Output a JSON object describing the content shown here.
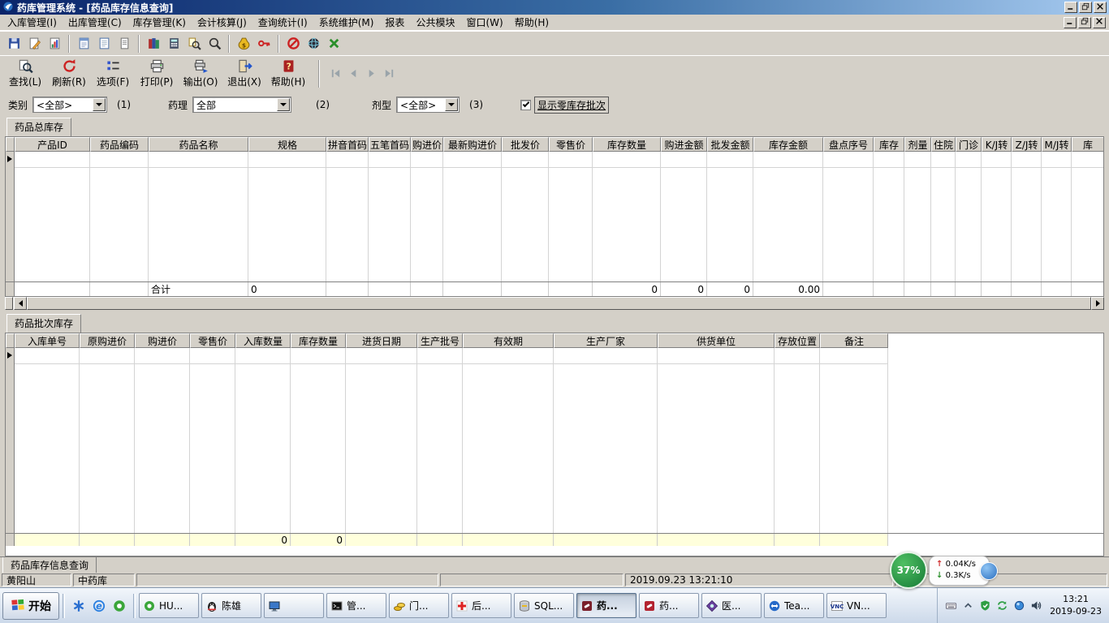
{
  "window": {
    "title": "药库管理系统 - [药品库存信息查询]"
  },
  "menu": {
    "items": [
      "入库管理(I)",
      "出库管理(C)",
      "库存管理(K)",
      "会计核算(J)",
      "查询统计(I)",
      "系统维护(M)",
      "报表",
      "公共模块",
      "窗口(W)",
      "帮助(H)"
    ]
  },
  "toolbar_small": {
    "icons": [
      "save",
      "edit",
      "report",
      "|",
      "notepad",
      "preview",
      "document",
      "|",
      "books",
      "calculator",
      "zoom-doc",
      "zoom",
      "|",
      "money",
      "key",
      "|",
      "forbid",
      "globe",
      "close-x"
    ]
  },
  "toolbar_actions": {
    "buttons": [
      {
        "icon": "search",
        "label": "查找(L)"
      },
      {
        "icon": "refresh",
        "label": "刷新(R)"
      },
      {
        "icon": "options",
        "label": "选项(F)"
      },
      {
        "icon": "printer",
        "label": "打印(P)"
      },
      {
        "icon": "export",
        "label": "输出(O)"
      },
      {
        "icon": "exit",
        "label": "退出(X)"
      },
      {
        "icon": "help",
        "label": "帮助(H)"
      }
    ],
    "nav": [
      "nav-first",
      "nav-prev",
      "nav-next",
      "nav-last"
    ]
  },
  "filters": {
    "category": {
      "label": "类别",
      "value": "<全部>",
      "hint": "(1)"
    },
    "pharmacology": {
      "label": "药理",
      "value": "全部",
      "hint": "(2)"
    },
    "dosage": {
      "label": "剂型",
      "value": "<全部>",
      "hint": "(3)"
    },
    "zero_stock": {
      "label": "显示零库存批次",
      "checked": true
    }
  },
  "stock_section": {
    "tab": "药品总库存",
    "columns": [
      "产品ID",
      "药品编码",
      "药品名称",
      "规格",
      "拼音首码",
      "五笔首码",
      "购进价",
      "最新购进价",
      "批发价",
      "零售价",
      "库存数量",
      "购进金额",
      "批发金额",
      "库存金额",
      "盘点序号",
      "库存",
      "剂量",
      "住院",
      "门诊",
      "K/J转",
      "Z/J转",
      "M/J转",
      "库"
    ],
    "summary": {
      "label": "合计",
      "spec": "0",
      "stock_qty": "0",
      "purchase_amount": "0",
      "wholesale_amount": "0",
      "stock_amount": "0.00"
    }
  },
  "batch_section": {
    "tab": "药品批次库存",
    "columns": [
      "入库单号",
      "原购进价",
      "购进价",
      "零售价",
      "入库数量",
      "库存数量",
      "进货日期",
      "生产批号",
      "有效期",
      "生产厂家",
      "供货单位",
      "存放位置",
      "备注"
    ],
    "summary": {
      "in_qty": "0",
      "stock_qty": "0"
    }
  },
  "bottom_tab": "药品库存信息查询",
  "status_bar": {
    "user": "黄阳山",
    "warehouse": "中药库",
    "datetime": "2019.09.23 13:21:10"
  },
  "net_widget": {
    "percent": "37%",
    "up": "0.04K/s",
    "down": "0.3K/s"
  },
  "taskbar": {
    "start": "开始",
    "quick_launch": [
      "asterisk-blue",
      "ie",
      "browser-green"
    ],
    "tasks": [
      {
        "icon": "browser-green",
        "label": "HU...",
        "active": false
      },
      {
        "icon": "qq",
        "label": "陈雄",
        "active": false
      },
      {
        "icon": "monitor",
        "label": "",
        "active": false
      },
      {
        "icon": "cmd",
        "label": "管...",
        "active": false
      },
      {
        "icon": "coins",
        "label": "门...",
        "active": false
      },
      {
        "icon": "red-cross",
        "label": "后...",
        "active": false
      },
      {
        "icon": "sql",
        "label": "SQL...",
        "active": false
      },
      {
        "icon": "pill-dark",
        "label": "药...",
        "active": true
      },
      {
        "icon": "pill-red",
        "label": "药...",
        "active": false
      },
      {
        "icon": "purple-app",
        "label": "医...",
        "active": false
      },
      {
        "icon": "teamviewer",
        "label": "Tea...",
        "active": false
      },
      {
        "icon": "vnc",
        "label": "VN...",
        "active": false
      }
    ],
    "tray_icons": [
      "keyboard",
      "chevron-up",
      "shield",
      "sync",
      "ball-blue",
      "volume"
    ],
    "clock": {
      "time": "13:21",
      "date": "2019-09-23"
    }
  }
}
